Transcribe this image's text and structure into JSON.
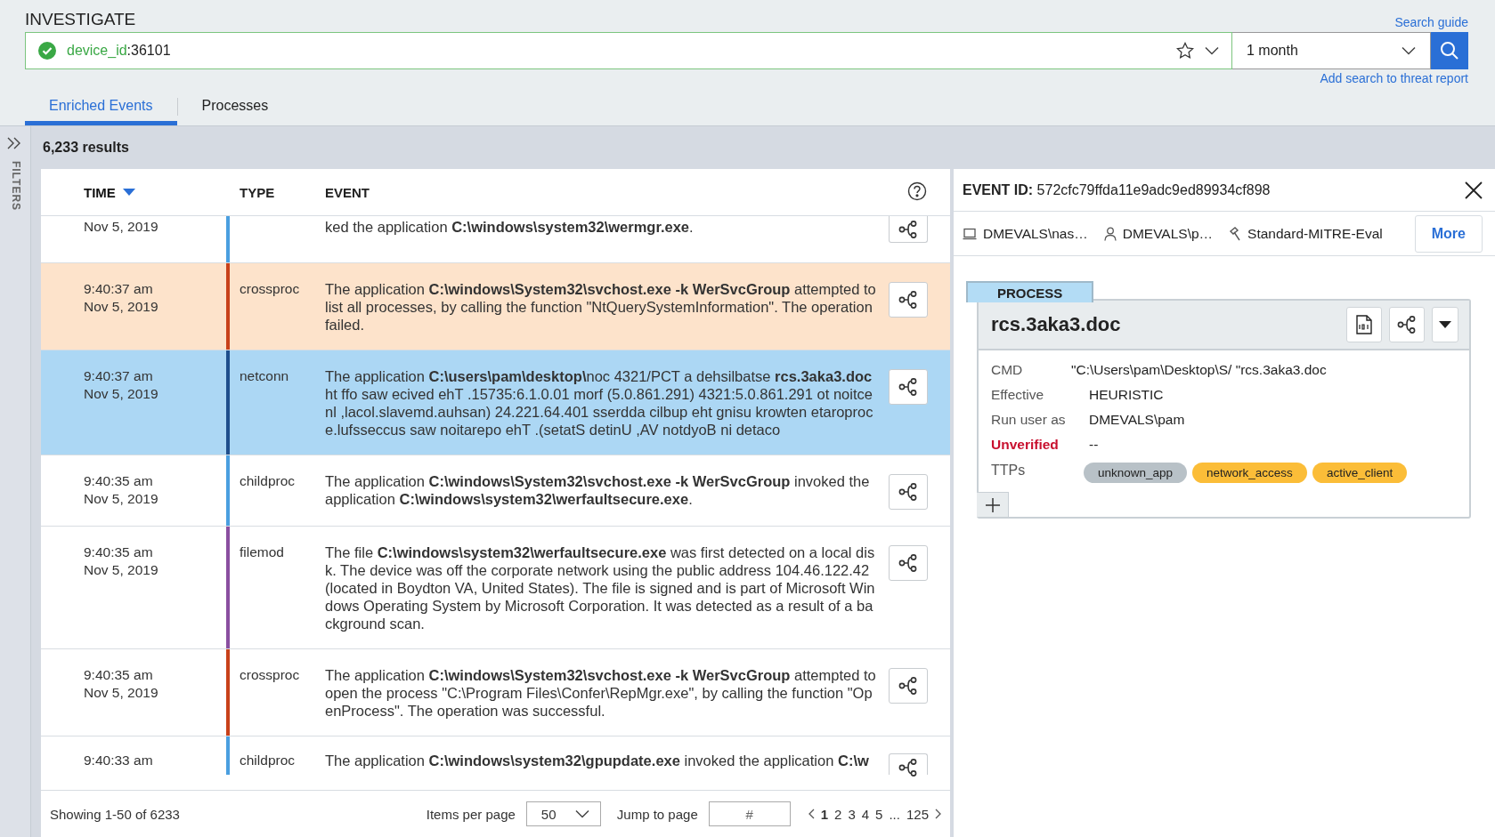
{
  "header": {
    "title": "INVESTIGATE",
    "search_guide": "Search guide",
    "query": {
      "key": "device_id",
      "rest": ":36101"
    },
    "time_range": "1 month",
    "add_report": "Add search to threat report"
  },
  "tabs": [
    {
      "label": "Enriched Events",
      "selected": true
    },
    {
      "label": "Processes",
      "selected": false
    }
  ],
  "filters_label": "FILTERS",
  "results": "6,233 results",
  "table": {
    "columns": [
      {
        "label": "TIME",
        "sorted": true
      },
      {
        "label": "TYPE",
        "sorted": false
      },
      {
        "label": "EVENT",
        "sorted": false
      }
    ],
    "rows": [
      {
        "date": "Nov 5, 2019",
        "color": "#4a9fe0",
        "event": "ked the application **C:\\windows\\system32\\wermgr.exe**.",
        "selected": false,
        "hovered": false
      },
      {
        "time": "9:40:37 am",
        "date": "Nov 5, 2019",
        "type": "crossproc",
        "color": "#c8411a",
        "event": "The application **C:\\windows\\System32\\svchost.exe -k WerSvcGroup** attempted to list all processes, by calling the function \"NtQuerySystemInformation\". The operation failed.",
        "selected": false,
        "hovered": true
      },
      {
        "time": "9:40:37 am",
        "date": "Nov 5, 2019",
        "type": "netconn",
        "color": "#1f4e8c",
        "event": "The application **C:\\users\\pam\\desktop\\**noc 4321/PCT a dehsilbatse **rcs.3aka3.doc** ht ffo saw ecived ehT .15735:6.1.0.01 morf (5.0.861.291) 4321:5.0.861.291 ot noitcenl ,lacol.slavemd.auhsan) 24.221.64.401 sserdda cilbup eht gnisu krowten etaroproc e.lufsseccus saw noitarepo ehT .(setatS detinU ,AV notdyoB ni detaco",
        "selected": true,
        "hovered": false
      },
      {
        "time": "9:40:35 am",
        "date": "Nov 5, 2019",
        "type": "childproc",
        "color": "#4a9fe0",
        "event": "The application **C:\\windows\\System32\\svchost.exe -k WerSvcGroup** invoked the application **C:\\windows\\system32\\werfaultsecure.exe**.",
        "selected": false,
        "hovered": false
      },
      {
        "time": "9:40:35 am",
        "date": "Nov 5, 2019",
        "type": "filemod",
        "color": "#8a4fa0",
        "event": "The file **C:\\windows\\system32\\werfaultsecure.exe** was first detected on a local disk. The device was off the corporate network using the public address 104.46.122.42 (located in Boydton VA, United States). The file is signed and is part of Microsoft Windows Operating System by Microsoft Corporation. It was detected as a result of a background scan.",
        "selected": false,
        "hovered": false
      },
      {
        "time": "9:40:35 am",
        "date": "Nov 5, 2019",
        "type": "crossproc",
        "color": "#c8411a",
        "event": "The application **C:\\windows\\System32\\svchost.exe -k WerSvcGroup** attempted to open the process \"C:\\Program Files\\Confer\\RepMgr.exe\", by calling the function \"OpenProcess\". The operation was successful.",
        "selected": false,
        "hovered": false
      },
      {
        "time": "9:40:33 am",
        "type": "childproc",
        "color": "#4a9fe0",
        "event": "The application **C:\\windows\\system32\\gpupdate.exe** invoked the application **C:\\w**",
        "selected": false,
        "hovered": false
      }
    ]
  },
  "pagination": {
    "summary": "Showing 1-50 of 6233",
    "items_label": "Items per page",
    "items_value": "50",
    "jump_label": "Jump to page",
    "jump_placeholder": "#",
    "gap": "...",
    "pages": [
      {
        "label": "1",
        "selected": true
      },
      {
        "label": "2",
        "selected": false
      },
      {
        "label": "3",
        "selected": false
      },
      {
        "label": "4",
        "selected": false
      },
      {
        "label": "5",
        "selected": false
      },
      {
        "label": "125",
        "selected": false
      }
    ]
  },
  "event_detail": {
    "id_label": "EVENT ID:",
    "id": "572cfc79ffda11e9adc9ed89934cf898",
    "tags": [
      {
        "kind": "device",
        "text": "DMEVALS\\nas…"
      },
      {
        "kind": "user",
        "text": "DMEVALS\\p…"
      },
      {
        "kind": "policy",
        "text": "Standard-MITRE-Eval"
      }
    ],
    "more": "More",
    "process": {
      "tab": "PROCESS",
      "name": "rcs.3aka3.doc",
      "fields": [
        {
          "label": "CMD",
          "value": "\"C:\\Users\\pam\\Desktop\\S/ \"rcs.3aka3.doc",
          "kind": "plain"
        },
        {
          "label": "Effective",
          "value": "HEURISTIC",
          "kind": "plain"
        },
        {
          "label": "Run user as",
          "value": "DMEVALS\\pam",
          "kind": "plain"
        },
        {
          "label": "Unverified",
          "value": "--",
          "kind": "alert"
        }
      ],
      "ttps_label": "TTPs",
      "ttps": [
        {
          "label": "unknown_app",
          "color": "#b8c1c7"
        },
        {
          "label": "network_access",
          "color": "#fbbd38"
        },
        {
          "label": "active_client",
          "color": "#fbbd38"
        }
      ]
    }
  }
}
